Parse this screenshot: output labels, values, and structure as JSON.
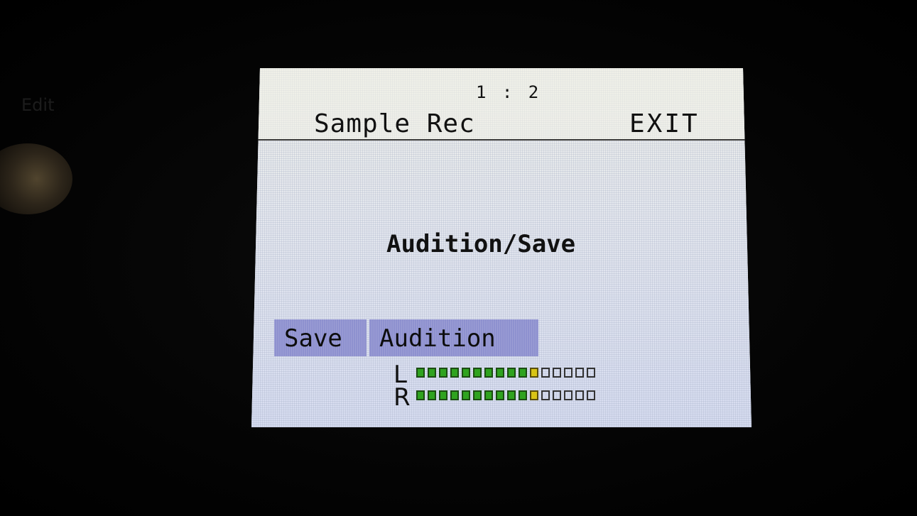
{
  "header": {
    "page_indicator": "1 : 2",
    "title": "Sample Rec",
    "exit_label": "EXIT"
  },
  "main": {
    "heading": "Audition/Save"
  },
  "buttons": {
    "save_label": "Save",
    "audition_label": "Audition"
  },
  "meters": {
    "segments_total": 16,
    "channels": [
      {
        "label": "L",
        "lit": 10,
        "peak_index": 10
      },
      {
        "label": "R",
        "lit": 10,
        "peak_index": 10
      }
    ]
  },
  "panel": {
    "knob_label": "Edit"
  },
  "colors": {
    "screen_bg": "#dfe3ef",
    "button_bg": "#8e91cf",
    "meter_on": "#2fa31f",
    "meter_peak": "#d8c416"
  }
}
